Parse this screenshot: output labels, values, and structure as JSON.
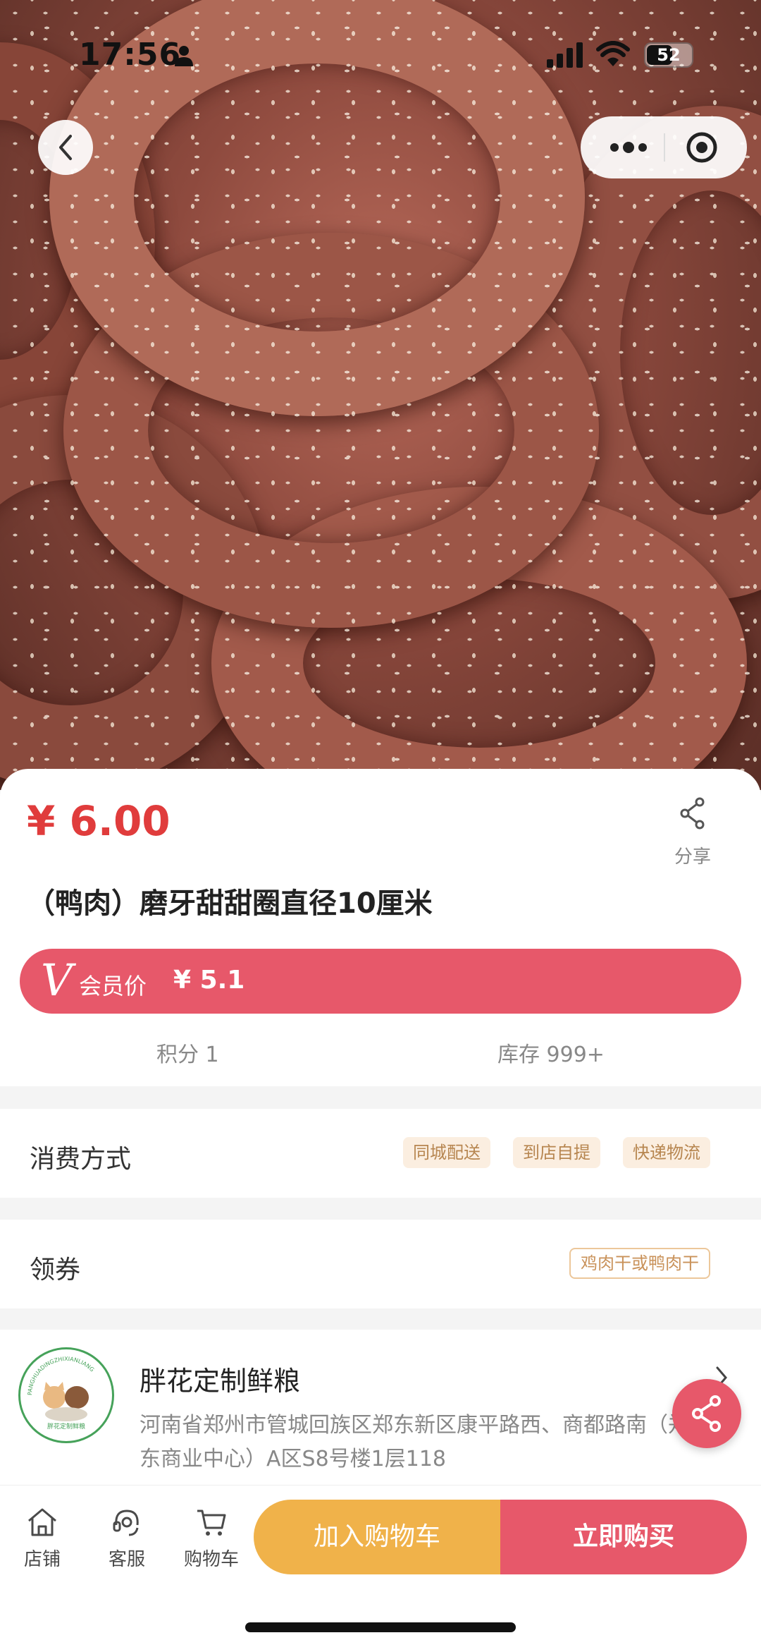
{
  "status": {
    "time": "17:56",
    "battery": "52"
  },
  "product": {
    "price": "¥ 6.00",
    "share_label": "分享",
    "title": "（鸭肉）磨牙甜甜圈直径10厘米",
    "member_badge": "V",
    "member_label": "会员价",
    "member_price": "¥ 5.1",
    "points": "积分 1",
    "stock": "库存 999+"
  },
  "consumption": {
    "label": "消费方式",
    "tags": [
      "同城配送",
      "到店自提",
      "快递物流"
    ]
  },
  "coupon": {
    "label": "领券",
    "tag": "鸡肉干或鸭肉干"
  },
  "store": {
    "name": "胖花定制鲜粮",
    "address": "河南省郑州市管城回族区郑东新区康平路西、商都路南（郑东商业中心）A区S8号楼1层118",
    "logo_text": "胖花定制鲜粮",
    "logo_ring_text": "PANGHUADINGZHIXIANLIANG"
  },
  "bottom": {
    "tabs": [
      {
        "label": "店铺",
        "icon": "home-icon"
      },
      {
        "label": "客服",
        "icon": "headset-icon"
      },
      {
        "label": "购物车",
        "icon": "cart-icon"
      }
    ],
    "add_to_cart": "加入购物车",
    "buy_now": "立即购买"
  },
  "colors": {
    "accent": "#e7586a",
    "price": "#e03c3c",
    "cart": "#f0b24a"
  }
}
